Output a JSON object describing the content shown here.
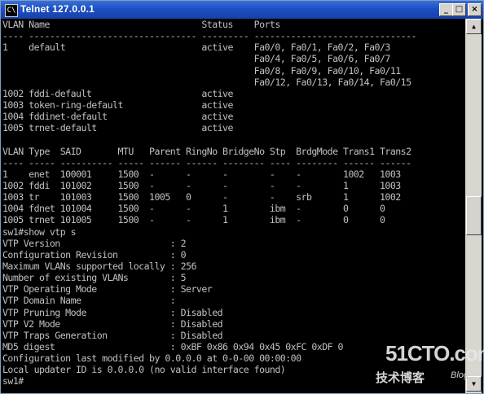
{
  "window": {
    "title": "Telnet 127.0.0.1",
    "icon_label": "C\\",
    "buttons": {
      "minimize": "_",
      "maximize": "□",
      "close": "×"
    }
  },
  "console_lines": [
    "VLAN Name                             Status    Ports",
    "---- -------------------------------- --------- -------------------------------",
    "1    default                          active    Fa0/0, Fa0/1, Fa0/2, Fa0/3",
    "                                                Fa0/4, Fa0/5, Fa0/6, Fa0/7",
    "                                                Fa0/8, Fa0/9, Fa0/10, Fa0/11",
    "                                                Fa0/12, Fa0/13, Fa0/14, Fa0/15",
    "1002 fddi-default                     active",
    "1003 token-ring-default               active",
    "1004 fddinet-default                  active",
    "1005 trnet-default                    active",
    "",
    "VLAN Type  SAID       MTU   Parent RingNo BridgeNo Stp  BrdgMode Trans1 Trans2",
    "---- ----- ---------- ----- ------ ------ -------- ---- -------- ------ ------",
    "1    enet  100001     1500  -      -      -        -    -        1002   1003",
    "1002 fddi  101002     1500  -      -      -        -    -        1      1003",
    "1003 tr    101003     1500  1005   0      -        -    srb      1      1002",
    "1004 fdnet 101004     1500  -      -      1        ibm  -        0      0",
    "1005 trnet 101005     1500  -      -      1        ibm  -        0      0",
    "sw1#show vtp s",
    "VTP Version                     : 2",
    "Configuration Revision          : 0",
    "Maximum VLANs supported locally : 256",
    "Number of existing VLANs        : 5",
    "VTP Operating Mode              : Server",
    "VTP Domain Name                 :",
    "VTP Pruning Mode                : Disabled",
    "VTP V2 Mode                     : Disabled",
    "VTP Traps Generation            : Disabled",
    "MD5 digest                      : 0xBF 0x86 0x94 0x45 0xFC 0xDF 0",
    "Configuration last modified by 0.0.0.0 at 0-0-00 00:00:00",
    "Local updater ID is 0.0.0.0 (no valid interface found)",
    "sw1#"
  ],
  "watermark": {
    "main": "51CTO.com",
    "cn": "技术博客",
    "blog": "Blog"
  },
  "scrollbar": {
    "up": "▲",
    "down": "▼"
  }
}
